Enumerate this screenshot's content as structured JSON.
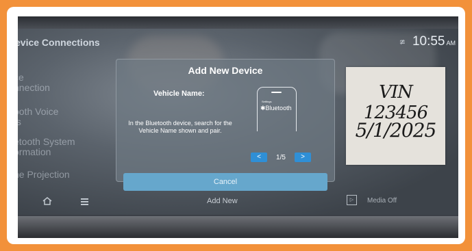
{
  "header": {
    "title": "evice Connections",
    "time": "10:55",
    "ampm": "AM"
  },
  "sidebar": {
    "items": [
      {
        "label": "ce\nnnection"
      },
      {
        "label": "ooth Voice\nts"
      },
      {
        "label": "etooth System\normation"
      },
      {
        "label": "ne Projection"
      }
    ]
  },
  "dialog": {
    "title": "Add New Device",
    "vehicle_name_label": "Vehicle Name:",
    "instructions": "In the Bluetooth device, search for the Vehicle Name shown and pair.",
    "phone_settings": "Settings",
    "phone_bluetooth": "Bluetooth",
    "pager": "1/5",
    "prev": "<",
    "next": ">",
    "cancel_label": "Cancel"
  },
  "bottom_bar": {
    "add_new_label": "Add New",
    "media_off_label": "Media Off"
  },
  "handwritten_note": {
    "vin": "VIN 123456",
    "date": "5/1/2025"
  },
  "colors": {
    "outer_border": "#f2913a",
    "accent_blue": "#2f8fd6",
    "cancel_button": "#66a7cc"
  },
  "icons": [
    "home-icon",
    "menu-icon",
    "media-off-icon",
    "bluetooth-icon",
    "signal-icon"
  ]
}
